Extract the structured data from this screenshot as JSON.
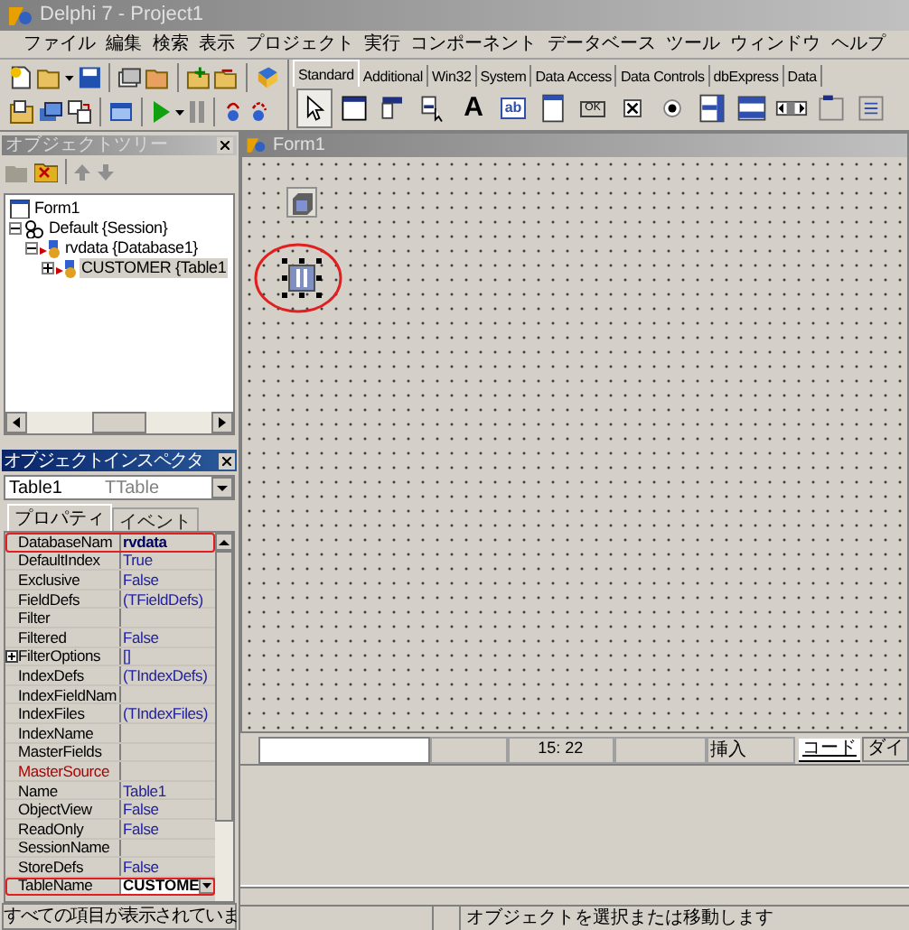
{
  "window": {
    "title": "Delphi 7 - Project1"
  },
  "menu": [
    "ファイル",
    "編集",
    "検索",
    "表示",
    "プロジェクト",
    "実行",
    "コンポーネント",
    "データベース",
    "ツール",
    "ウィンドウ",
    "ヘルプ"
  ],
  "palette": {
    "tabs": [
      {
        "label": "Standard",
        "selected": true
      },
      {
        "label": "Additional",
        "selected": false
      },
      {
        "label": "Win32",
        "selected": false
      },
      {
        "label": "System",
        "selected": false
      },
      {
        "label": "Data Access",
        "selected": false
      },
      {
        "label": "Data Controls",
        "selected": false
      },
      {
        "label": "dbExpress",
        "selected": false
      },
      {
        "label": "Data",
        "selected": false
      }
    ],
    "components": [
      {
        "kind": "pointer",
        "selected": true
      },
      {
        "kind": "frame",
        "selected": false
      },
      {
        "kind": "menu",
        "selected": false
      },
      {
        "kind": "popup",
        "selected": false
      },
      {
        "kind": "glyph",
        "text": "A",
        "selected": false
      },
      {
        "kind": "edit",
        "text": "ab",
        "selected": false
      },
      {
        "kind": "memo",
        "selected": false
      },
      {
        "kind": "button",
        "text": "OK",
        "selected": false
      },
      {
        "kind": "check",
        "selected": false
      },
      {
        "kind": "radio",
        "selected": false
      },
      {
        "kind": "list",
        "selected": false
      },
      {
        "kind": "combo",
        "selected": false
      },
      {
        "kind": "scroll",
        "selected": false
      },
      {
        "kind": "group",
        "selected": false
      },
      {
        "kind": "radiogroup",
        "selected": false
      }
    ]
  },
  "object_tree": {
    "title": "オブジェクトツリー",
    "items": [
      {
        "label": "Form1",
        "kind": "form",
        "selected": false
      },
      {
        "label": "Default {Session}",
        "kind": "session",
        "selected": false,
        "expanded": true,
        "children": [
          {
            "label": "rvdata {Database1}",
            "kind": "database",
            "selected": false,
            "expanded": true,
            "children": [
              {
                "label": "CUSTOMER {Table1",
                "kind": "table",
                "selected": true,
                "expanded": false
              }
            ]
          }
        ]
      }
    ]
  },
  "object_inspector": {
    "title": "オブジェクトインスペクタ",
    "object": "Table1",
    "object_type": "TTable",
    "tabs": [
      {
        "label": "プロパティ",
        "selected": true
      },
      {
        "label": "イベント",
        "selected": false
      }
    ],
    "properties": [
      {
        "name": "DatabaseNam",
        "value": "rvdata",
        "kind": "text",
        "modified": true,
        "reference": false,
        "highlighted": true
      },
      {
        "name": "DefaultIndex",
        "value": "True",
        "kind": "text",
        "modified": false,
        "reference": false,
        "highlighted": false
      },
      {
        "name": "Exclusive",
        "value": "False",
        "kind": "text",
        "modified": false,
        "reference": false,
        "highlighted": false
      },
      {
        "name": "FieldDefs",
        "value": "(TFieldDefs)",
        "kind": "text",
        "modified": false,
        "reference": false,
        "highlighted": false
      },
      {
        "name": "Filter",
        "kind": "text",
        "reference": false,
        "highlighted": false
      },
      {
        "name": "Filtered",
        "value": "False",
        "kind": "text",
        "modified": false,
        "reference": false,
        "highlighted": false
      },
      {
        "name": "FilterOptions",
        "value": "[]",
        "kind": "expandable",
        "modified": false,
        "reference": false,
        "highlighted": false
      },
      {
        "name": "IndexDefs",
        "value": "(TIndexDefs)",
        "kind": "text",
        "modified": false,
        "reference": false,
        "highlighted": false
      },
      {
        "name": "IndexFieldNam",
        "kind": "text",
        "reference": false,
        "highlighted": false
      },
      {
        "name": "IndexFiles",
        "value": "(TIndexFiles)",
        "kind": "text",
        "modified": false,
        "reference": false,
        "highlighted": false
      },
      {
        "name": "IndexName",
        "kind": "text",
        "reference": false,
        "highlighted": false
      },
      {
        "name": "MasterFields",
        "kind": "text",
        "reference": false,
        "highlighted": false
      },
      {
        "name": "MasterSource",
        "kind": "text",
        "reference": true,
        "highlighted": false
      },
      {
        "name": "Name",
        "value": "Table1",
        "kind": "text",
        "modified": false,
        "reference": false,
        "highlighted": false
      },
      {
        "name": "ObjectView",
        "value": "False",
        "kind": "text",
        "modified": false,
        "reference": false,
        "highlighted": false
      },
      {
        "name": "ReadOnly",
        "value": "False",
        "kind": "text",
        "modified": false,
        "reference": false,
        "highlighted": false
      },
      {
        "name": "SessionName",
        "kind": "text",
        "reference": false,
        "highlighted": false
      },
      {
        "name": "StoreDefs",
        "value": "False",
        "kind": "text",
        "modified": false,
        "reference": false,
        "highlighted": false
      },
      {
        "name": "TableName",
        "value": "CUSTOME",
        "kind": "dropdown",
        "modified": true,
        "reference": false,
        "highlighted": true
      }
    ],
    "hint": "すべての項目が表示されていま"
  },
  "form": {
    "title": "Form1",
    "components": [
      {
        "kind": "database",
        "selected": false,
        "highlighted": false
      },
      {
        "kind": "table",
        "selected": true,
        "highlighted": true
      }
    ]
  },
  "editor_status": {
    "cursor": "15: 22",
    "mode": "挿入",
    "tabs": [
      {
        "label": "コード",
        "selected": true
      },
      {
        "label": "ダイ",
        "selected": false
      }
    ]
  },
  "status_bar": "オブジェクトを選択または移動します"
}
